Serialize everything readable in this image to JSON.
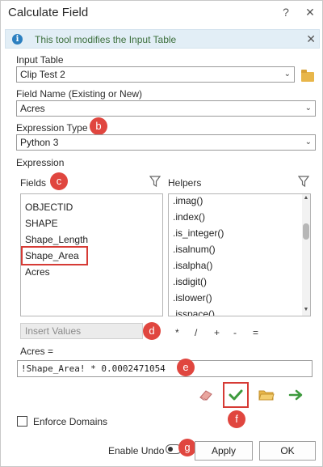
{
  "window": {
    "title": "Calculate Field",
    "help_label": "?",
    "close_label": "✕"
  },
  "info": {
    "icon_label": "i",
    "message": "This tool modifies the Input Table",
    "close_label": "✕"
  },
  "input_table": {
    "label": "Input Table",
    "value": "Clip Test 2"
  },
  "field_name": {
    "label": "Field Name (Existing or New)",
    "value": "Acres"
  },
  "expression_type": {
    "label": "Expression Type",
    "value": "Python 3"
  },
  "expression": {
    "label": "Expression",
    "fields_label": "Fields",
    "helpers_label": "Helpers",
    "fields": [
      "OBJECTID",
      "SHAPE",
      "Shape_Length",
      "Shape_Area",
      "Acres"
    ],
    "highlighted_field": "Shape_Area",
    "helpers": [
      ".imag()",
      ".index()",
      ".is_integer()",
      ".isalnum()",
      ".isalpha()",
      ".isdigit()",
      ".islower()",
      ".isspace()"
    ],
    "insert_values_placeholder": "Insert Values",
    "operators": [
      "*",
      "/",
      "+",
      "-",
      "="
    ],
    "target_label": "Acres =",
    "code": "!Shape_Area! *  0.0002471054"
  },
  "badges": {
    "b": "b",
    "c": "c",
    "d": "d",
    "e": "e",
    "f": "f",
    "g": "g"
  },
  "enforce_domains_label": "Enforce Domains",
  "enable_undo_label": "Enable Undo",
  "apply_label": "Apply",
  "ok_label": "OK",
  "colors": {
    "badge": "#e0463f",
    "highlight": "#d63b35",
    "verify_check": "#3d9a3d",
    "info_bar": "#e2eef6"
  },
  "icons": {
    "folder": "folder-icon",
    "filter": "filter-icon",
    "eraser": "eraser-icon",
    "verify": "check-icon",
    "open": "open-folder-icon",
    "run": "arrow-right-icon"
  }
}
